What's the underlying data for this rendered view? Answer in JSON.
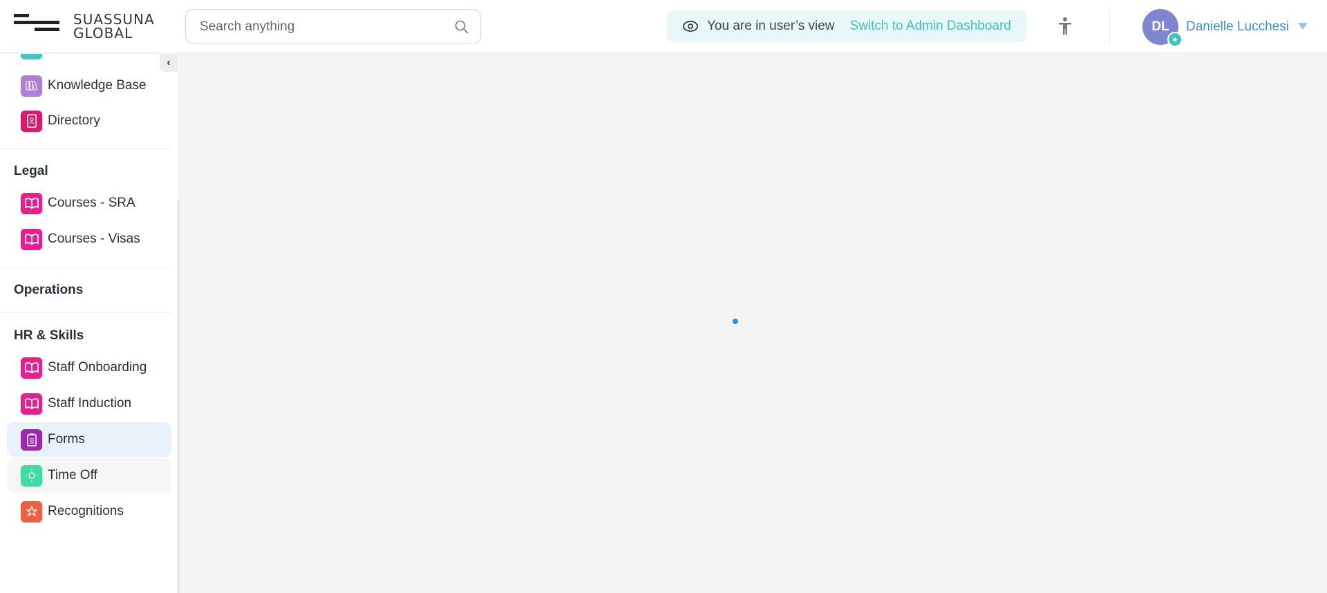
{
  "header": {
    "logo_line1": "SUASSUNA",
    "logo_line2": "GLOBAL",
    "search_placeholder": "Search anything",
    "view_notice": "You are in user’s view",
    "switch_link": "Switch to Admin Dashboard",
    "user": {
      "initials": "DL",
      "name": "Danielle Lucchesi"
    }
  },
  "sidebar": {
    "top_items": [
      {
        "label": "Knowledge Base",
        "color": "#b07fd6"
      },
      {
        "label": "Directory",
        "color": "#d81b6a"
      }
    ],
    "sections": [
      {
        "title": "Legal",
        "items": [
          {
            "label": "Courses - SRA",
            "color": "#e91e8c"
          },
          {
            "label": "Courses - Visas",
            "color": "#e91e8c"
          }
        ]
      },
      {
        "title": "Operations",
        "items": []
      },
      {
        "title": "HR & Skills",
        "items": [
          {
            "label": "Staff Onboarding",
            "color": "#e91e8c"
          },
          {
            "label": "Staff Induction",
            "color": "#e91e8c"
          },
          {
            "label": "Forms",
            "color": "#9c27b0",
            "active": true
          },
          {
            "label": "Time Off",
            "color": "#3ddc9f"
          },
          {
            "label": "Recognitions",
            "color": "#f06040"
          }
        ]
      }
    ]
  },
  "colors": {
    "accent": "#3cc3c0",
    "link": "#3d8fe0",
    "loader": "#2f8ef0"
  }
}
